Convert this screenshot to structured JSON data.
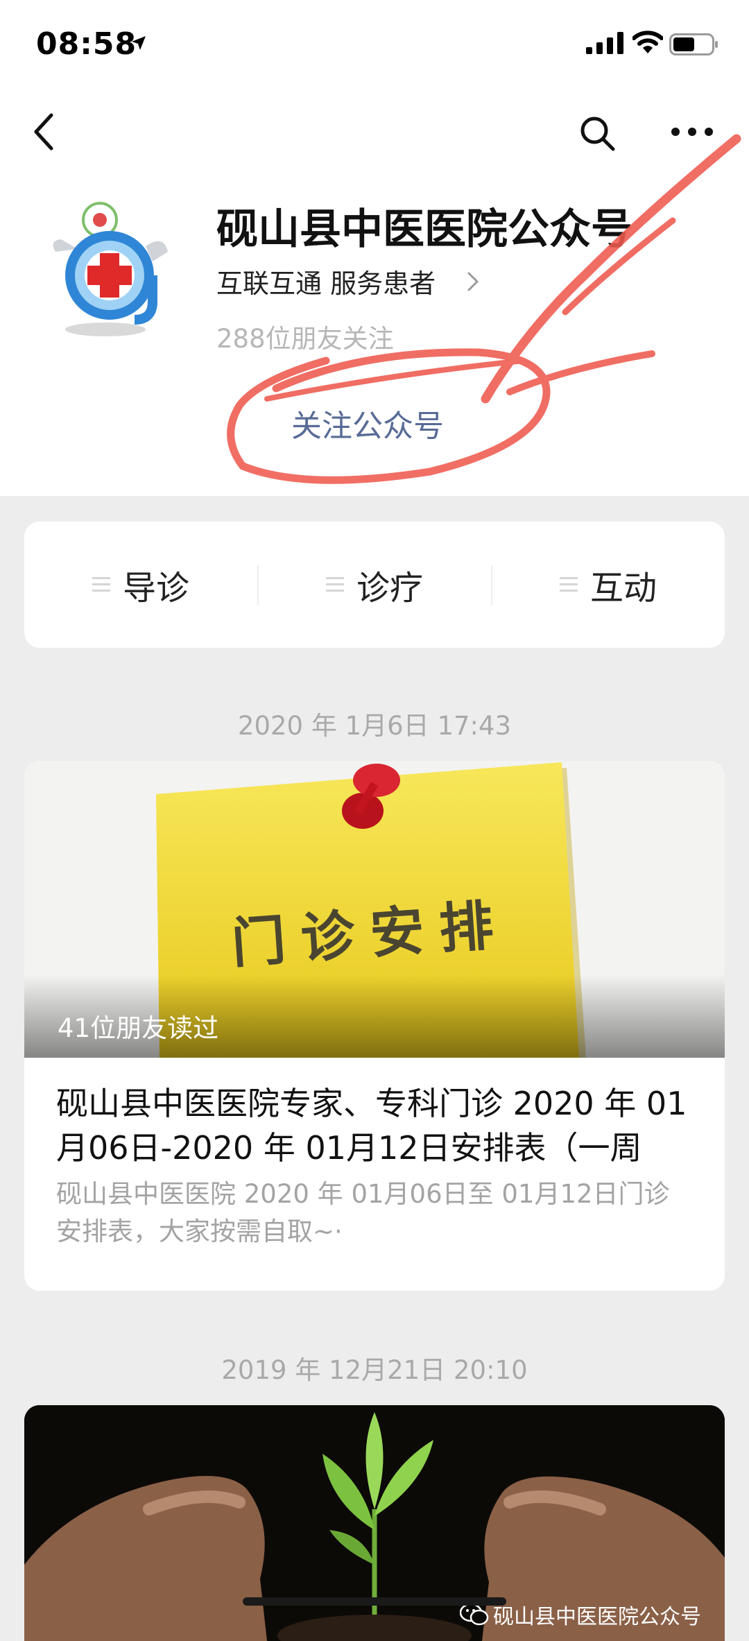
{
  "status_bar": {
    "time": "08:58"
  },
  "nav": {
    "back": "back",
    "search": "search",
    "more": "more"
  },
  "account": {
    "name": "砚山县中医医院公众号",
    "description": "互联互通 服务患者",
    "followers": "288位朋友关注",
    "follow_label": "关注公众号"
  },
  "menu": [
    {
      "label": "导诊",
      "icon": "menu-lines-icon"
    },
    {
      "label": "诊疗",
      "icon": "menu-lines-icon"
    },
    {
      "label": "互动",
      "icon": "menu-lines-icon"
    }
  ],
  "articles": [
    {
      "date": "2020 年 1月6日 17:43",
      "cover_text": "门诊安排",
      "read_count": "41位朋友读过",
      "title": "砚山县中医医院专家、专科门诊 2020 年 01月06日-2020 年 01月12日安排表（一周",
      "digest": "砚山县中医医院 2020 年 01月06日至 01月12日门诊安排表，大家按需自取~·"
    },
    {
      "date": "2019 年 12月21日 20:10",
      "watermark": "砚山县中医医院公众号"
    }
  ],
  "colors": {
    "link": "#576b95",
    "annotation": "#ef5a4e",
    "background": "#ededed"
  }
}
